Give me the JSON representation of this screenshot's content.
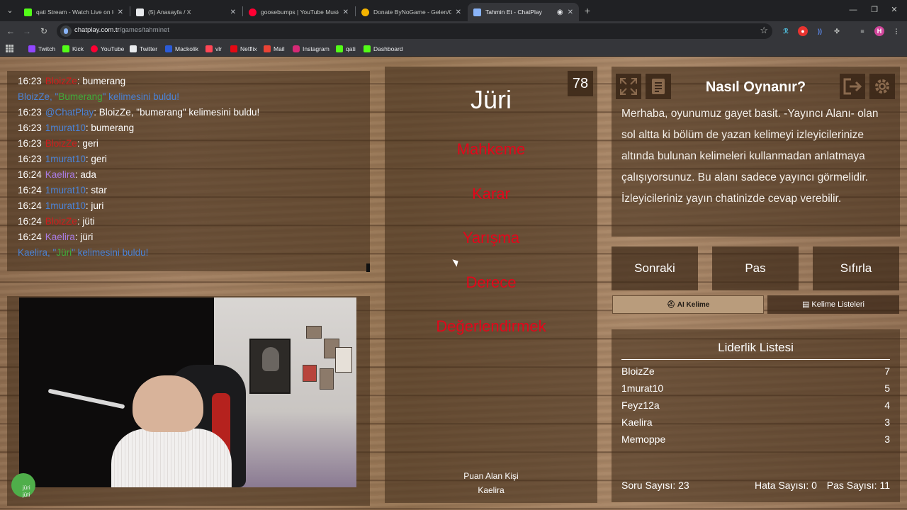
{
  "browser": {
    "tabs": [
      {
        "title": "qati Stream - Watch Live on Kick",
        "color": "#53fc18",
        "active": false
      },
      {
        "title": "(5) Anasayfa / X",
        "color": "#e8eaed",
        "active": false
      },
      {
        "title": "goosebumps | YouTube Music",
        "color": "#ff0033",
        "active": false
      },
      {
        "title": "Donate ByNoGame - Gelen/Giden",
        "color": "#f4b400",
        "active": false
      },
      {
        "title": "Tahmin Et - ChatPlay",
        "color": "#8ab4f8",
        "active": true
      }
    ],
    "url_host": "chatplay.com.tr",
    "url_path": "/games/tahminet",
    "profile_initial": "H",
    "bookmarks": [
      {
        "label": "Twitch",
        "color": "#9146ff"
      },
      {
        "label": "Kick",
        "color": "#53fc18"
      },
      {
        "label": "YouTube",
        "color": "#ff0033"
      },
      {
        "label": "Twitter",
        "color": "#e8eaed"
      },
      {
        "label": "Mackolik",
        "color": "#2b5bd7"
      },
      {
        "label": "vlr",
        "color": "#ff4655"
      },
      {
        "label": "Netflix",
        "color": "#e50914"
      },
      {
        "label": "Mail",
        "color": "#ea4335"
      },
      {
        "label": "Instagram",
        "color": "#d62976"
      },
      {
        "label": "qati",
        "color": "#53fc18"
      },
      {
        "label": "Dashboard",
        "color": "#53fc18"
      }
    ]
  },
  "chat": {
    "lines": [
      {
        "time": "16:23",
        "user": "BloizZe",
        "user_color": "#d01c1c",
        "msg": ": bumerang",
        "sys": false
      },
      {
        "time": "",
        "user": "BloizZe, \"",
        "user_color": "#4b83d6",
        "word": "Bumerang",
        "msg": "\" kelimesini buldu!",
        "sys": true
      },
      {
        "time": "16:23",
        "user": "@ChatPlay",
        "user_color": "#4b83d6",
        "msg": ": BloizZe, \"bumerang\" kelimesini buldu!",
        "sys": false
      },
      {
        "time": "16:23",
        "user": "1murat10",
        "user_color": "#4b83d6",
        "msg": ": bumerang",
        "sys": false
      },
      {
        "time": "16:23",
        "user": "BloizZe",
        "user_color": "#d01c1c",
        "msg": ": geri",
        "sys": false
      },
      {
        "time": "16:23",
        "user": "1murat10",
        "user_color": "#4b83d6",
        "msg": ": geri",
        "sys": false
      },
      {
        "time": "16:24",
        "user": "Kaelira",
        "user_color": "#a97be3",
        "msg": ": ada",
        "sys": false
      },
      {
        "time": "16:24",
        "user": "1murat10",
        "user_color": "#4b83d6",
        "msg": ": star",
        "sys": false
      },
      {
        "time": "16:24",
        "user": "1murat10",
        "user_color": "#4b83d6",
        "msg": ": juri",
        "sys": false
      },
      {
        "time": "16:24",
        "user": "BloizZe",
        "user_color": "#d01c1c",
        "msg": ": jüti",
        "sys": false
      },
      {
        "time": "16:24",
        "user": "Kaelira",
        "user_color": "#a97be3",
        "msg": ": jüri",
        "sys": false
      },
      {
        "time": "",
        "user": "Kaelira, \"",
        "user_color": "#4b83d6",
        "word": "Jüri",
        "msg": "\" kelimesini buldu!",
        "sys": true
      }
    ]
  },
  "webcam": {
    "overlay_lines": [
      "jüri",
      "jüti"
    ]
  },
  "game": {
    "counter": "78",
    "target_word": "Jüri",
    "forbidden_words": [
      "Mahkeme",
      "Karar",
      "Yarışma",
      "Derece",
      "Değerlendirmek"
    ],
    "scorer_label": "Puan Alan Kişi",
    "scorer_name": "Kaelira"
  },
  "howto": {
    "title": "Nasıl Oynanır?",
    "text": "Merhaba, oyunumuz gayet basit. -Yayıncı Alanı- olan sol altta ki bölüm de yazan kelimeyi izleyicilerinize altında bulunan kelimeleri kullanmadan anlatmaya çalışıyorsunuz. Bu alanı sadece yayıncı görmelidir. İzleyicileriniz yayın chatinizde cevap verebilir."
  },
  "buttons": {
    "next": "Sonraki",
    "pass": "Pas",
    "reset": "Sıfırla",
    "ai_word": "AI Kelime",
    "word_lists": "Kelime Listeleri"
  },
  "leaderboard": {
    "title": "Liderlik Listesi",
    "rows": [
      {
        "name": "BloizZe",
        "score": "7"
      },
      {
        "name": "1murat10",
        "score": "5"
      },
      {
        "name": "Feyz12a",
        "score": "4"
      },
      {
        "name": "Kaelira",
        "score": "3"
      },
      {
        "name": "Memoppe",
        "score": "3"
      }
    ],
    "question_count": "Soru Sayısı: 23",
    "error_count": "Hata Sayısı: 0",
    "pass_count": "Pas Sayısı: 11"
  }
}
